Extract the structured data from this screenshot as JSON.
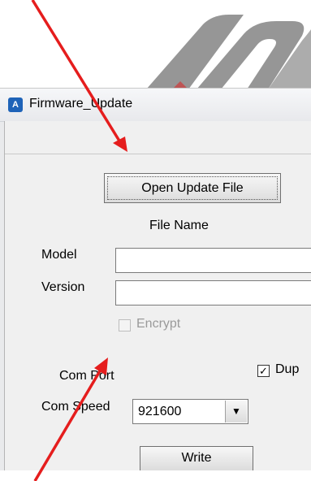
{
  "window": {
    "title": "Firmware_Update",
    "app_icon_glyph": "A"
  },
  "buttons": {
    "open_update_file": "Open Update File",
    "write": "Write"
  },
  "labels": {
    "file_name": "File Name",
    "model": "Model",
    "version": "Version",
    "encrypt": "Encrypt",
    "com_port": "Com Port",
    "com_speed": "Com Speed",
    "dup": "Dup"
  },
  "fields": {
    "model_value": "",
    "version_value": ""
  },
  "checkboxes": {
    "encrypt_checked": false,
    "encrypt_enabled": false,
    "dup_checked": true,
    "dup_mark": "✓"
  },
  "com_speed_select": {
    "selected": "921600",
    "dropdown_glyph": "▼"
  },
  "colors": {
    "annotation_arrow": "#e51d1d",
    "logo_gray": "#8e8e8e",
    "logo_red": "#e02020"
  },
  "icons": [
    "app-icon",
    "chevron-down-icon",
    "checkmark-icon"
  ]
}
